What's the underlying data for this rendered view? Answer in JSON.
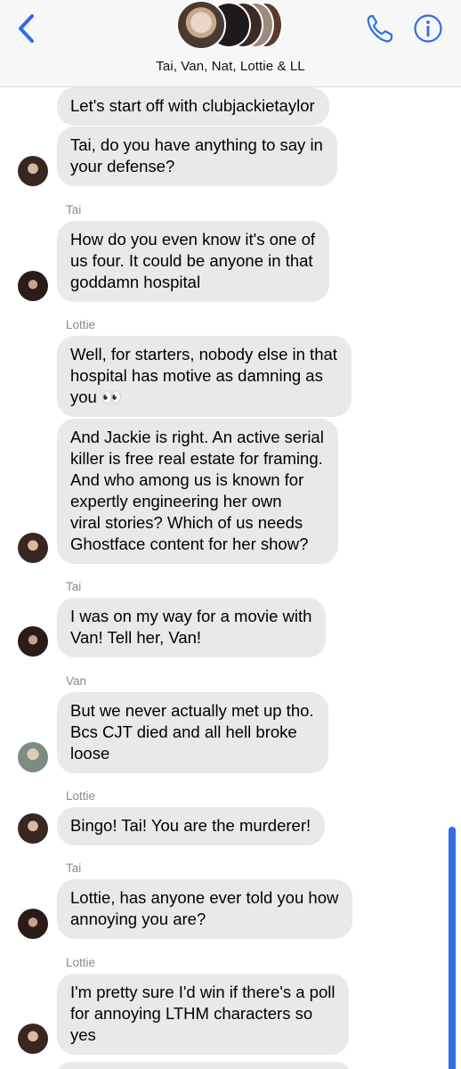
{
  "header": {
    "title": "Tai, Van, Nat, Lottie & LL",
    "back_icon": "chevron-left-icon",
    "phone_icon": "phone-icon",
    "info_icon": "info-icon",
    "accent_color": "#2f6ee6"
  },
  "messages": [
    {
      "sender": "",
      "text": "Let's start off with clubjackietaylor",
      "avatar": ""
    },
    {
      "sender": "",
      "text": "Tai, do you have anything to say in\nyour defense?",
      "avatar": "lottie-avatar"
    },
    {
      "sender": "Tai",
      "text": "How do you even know it's one of\nus four. It could be anyone in that\ngoddamn hospital",
      "avatar": "tai-avatar"
    },
    {
      "sender": "Lottie",
      "text": "Well, for starters, nobody else in that\nhospital has motive as damning as\nyou 👀",
      "avatar": ""
    },
    {
      "sender": "",
      "text": "And Jackie is right. An active serial\nkiller is free real estate for framing.\nAnd who among us is known for\nexpertly engineering her own\nviral stories? Which of us needs\nGhostface content for her show?",
      "avatar": "lottie-avatar"
    },
    {
      "sender": "Tai",
      "text": "I was on my way for a movie with\nVan! Tell her, Van!",
      "avatar": "tai-avatar"
    },
    {
      "sender": "Van",
      "text": "But we never actually met up tho.\nBcs CJT died and all hell broke\nloose",
      "avatar": "van-avatar"
    },
    {
      "sender": "Lottie",
      "text": "Bingo! Tai! You are the murderer!",
      "avatar": "lottie-avatar"
    },
    {
      "sender": "Tai",
      "text": "Lottie, has anyone ever told you how\nannoying you are?",
      "avatar": "tai-avatar"
    },
    {
      "sender": "Lottie",
      "text": "I'm pretty sure I'd win if there's a poll\nfor annoying LTHM characters so\nyes",
      "avatar": "lottie-avatar"
    }
  ]
}
